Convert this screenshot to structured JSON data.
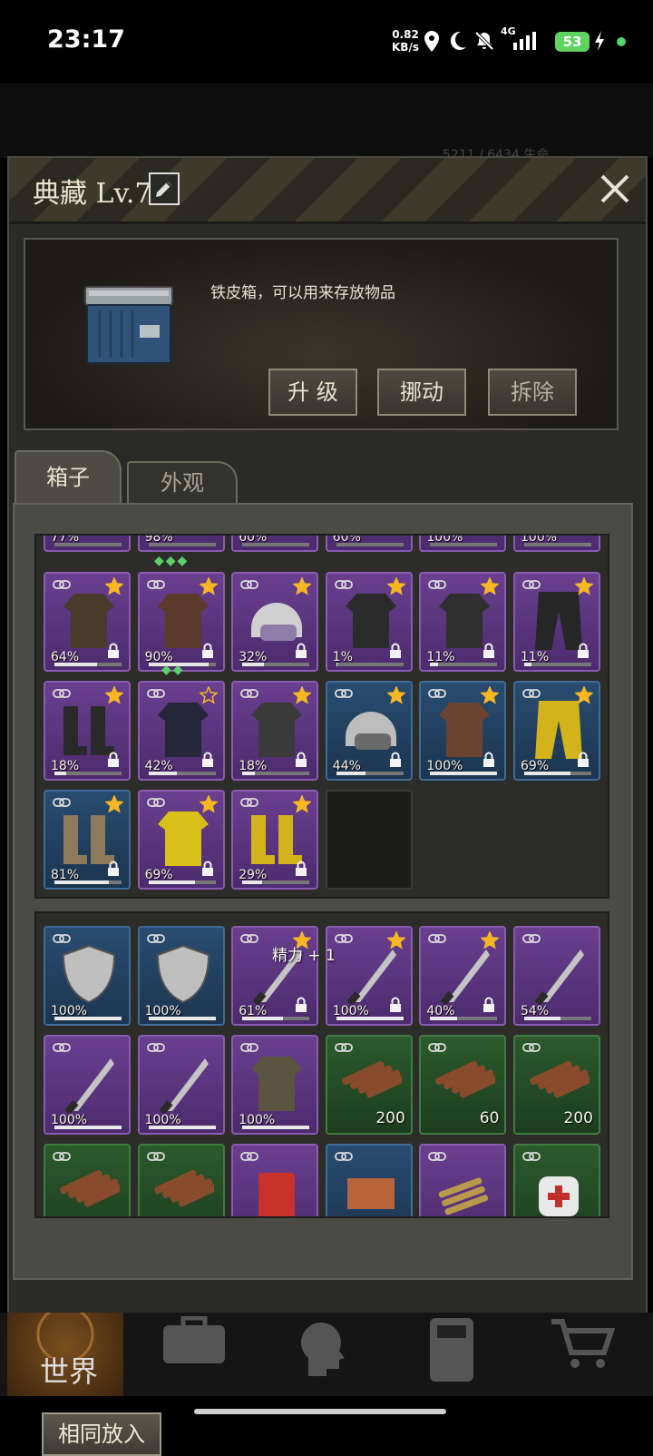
{
  "status_bar": {
    "time": "23:17",
    "net_speed_value": "0.82",
    "net_speed_unit": "KB/s",
    "signal": "4G",
    "battery": "53"
  },
  "background": {
    "hint": "5211 / 6434  生命"
  },
  "dialog": {
    "title": "典藏 Lv.7",
    "description": "铁皮箱，可以用来存放物品",
    "buttons": {
      "upgrade": "升 级",
      "move": "挪动",
      "dismantle": "拆除"
    },
    "tabs": {
      "box": "箱子",
      "appearance": "外观"
    }
  },
  "equipment_top_row": [
    {
      "rarity": "purple",
      "percent": "77%"
    },
    {
      "rarity": "purple",
      "percent": "98%"
    },
    {
      "rarity": "purple",
      "percent": "60%"
    },
    {
      "rarity": "purple",
      "percent": "60%"
    },
    {
      "rarity": "purple",
      "percent": "100%"
    },
    {
      "rarity": "purple",
      "percent": "100%"
    }
  ],
  "equipment": [
    {
      "rarity": "purple",
      "icon": "bow-icon",
      "percent": "64%",
      "durability": 0.64,
      "star": "filled",
      "locked": true
    },
    {
      "rarity": "purple",
      "icon": "crossbow-icon",
      "percent": "90%",
      "durability": 0.9,
      "star": "filled",
      "locked": true
    },
    {
      "rarity": "purple",
      "icon": "police-helmet-icon",
      "percent": "32%",
      "durability": 0.32,
      "star": "filled",
      "locked": true
    },
    {
      "rarity": "purple",
      "icon": "leather-jacket-icon",
      "percent": "1%",
      "durability": 0.01,
      "star": "filled",
      "locked": true
    },
    {
      "rarity": "purple",
      "icon": "black-jacket-icon",
      "percent": "11%",
      "durability": 0.11,
      "star": "filled",
      "locked": true
    },
    {
      "rarity": "purple",
      "icon": "cargo-pants-icon",
      "percent": "11%",
      "durability": 0.11,
      "star": "filled",
      "locked": true
    },
    {
      "rarity": "purple",
      "icon": "combat-boots-icon",
      "percent": "18%",
      "durability": 0.18,
      "star": "filled",
      "locked": true
    },
    {
      "rarity": "purple",
      "icon": "police-vest-icon",
      "percent": "42%",
      "durability": 0.42,
      "star": "outline",
      "locked": true
    },
    {
      "rarity": "purple",
      "icon": "tactical-vest-icon",
      "percent": "18%",
      "durability": 0.18,
      "star": "filled",
      "locked": true
    },
    {
      "rarity": "blue",
      "icon": "motorcycle-helmet-icon",
      "percent": "44%",
      "durability": 0.44,
      "star": "filled",
      "locked": true
    },
    {
      "rarity": "blue",
      "icon": "brown-coat-icon",
      "percent": "100%",
      "durability": 1.0,
      "star": "filled",
      "locked": true
    },
    {
      "rarity": "blue",
      "icon": "yellow-pants-icon",
      "percent": "69%",
      "durability": 0.69,
      "star": "filled",
      "locked": true
    },
    {
      "rarity": "blue",
      "icon": "sneakers-icon",
      "percent": "81%",
      "durability": 0.81,
      "star": "filled",
      "locked": true
    },
    {
      "rarity": "purple",
      "icon": "yellow-raincoat-icon",
      "percent": "69%",
      "durability": 0.69,
      "star": "filled",
      "locked": true
    },
    {
      "rarity": "purple",
      "icon": "yellow-boots-icon",
      "percent": "29%",
      "durability": 0.29,
      "star": "filled",
      "locked": true
    },
    {
      "rarity": "empty"
    }
  ],
  "storage": [
    {
      "rarity": "blue",
      "icon": "shield-icon",
      "percent": "100%",
      "durability": 1.0
    },
    {
      "rarity": "blue",
      "icon": "shield-icon",
      "percent": "100%",
      "durability": 1.0
    },
    {
      "rarity": "purple",
      "icon": "machete-icon",
      "percent": "61%",
      "durability": 0.61,
      "star": "filled",
      "locked": true
    },
    {
      "rarity": "purple",
      "icon": "machete-icon",
      "percent": "100%",
      "durability": 1.0,
      "star": "filled",
      "locked": true
    },
    {
      "rarity": "purple",
      "icon": "machete-icon",
      "percent": "40%",
      "durability": 0.4,
      "star": "filled",
      "locked": true
    },
    {
      "rarity": "purple",
      "icon": "machete-icon",
      "percent": "54%",
      "durability": 0.54
    },
    {
      "rarity": "purple",
      "icon": "machete-icon",
      "percent": "100%",
      "durability": 1.0
    },
    {
      "rarity": "purple",
      "icon": "machete-icon",
      "percent": "100%",
      "durability": 1.0
    },
    {
      "rarity": "purple",
      "icon": "parka-icon",
      "percent": "100%",
      "durability": 1.0
    },
    {
      "rarity": "green",
      "icon": "wood-icon",
      "count": "200"
    },
    {
      "rarity": "green",
      "icon": "wood-icon",
      "count": "60"
    },
    {
      "rarity": "green",
      "icon": "wood-icon",
      "count": "200"
    },
    {
      "rarity": "green",
      "icon": "wood-icon"
    },
    {
      "rarity": "green",
      "icon": "wood-icon"
    },
    {
      "rarity": "purple",
      "icon": "gas-can-icon"
    },
    {
      "rarity": "blue",
      "icon": "ammo-box-icon"
    },
    {
      "rarity": "purple",
      "icon": "bullets-icon"
    },
    {
      "rarity": "green",
      "icon": "bandage-icon"
    }
  ],
  "buff_text": "精力 + 1",
  "same_put_in_button": "相同放入",
  "bottom_nav": {
    "world": "世界"
  }
}
